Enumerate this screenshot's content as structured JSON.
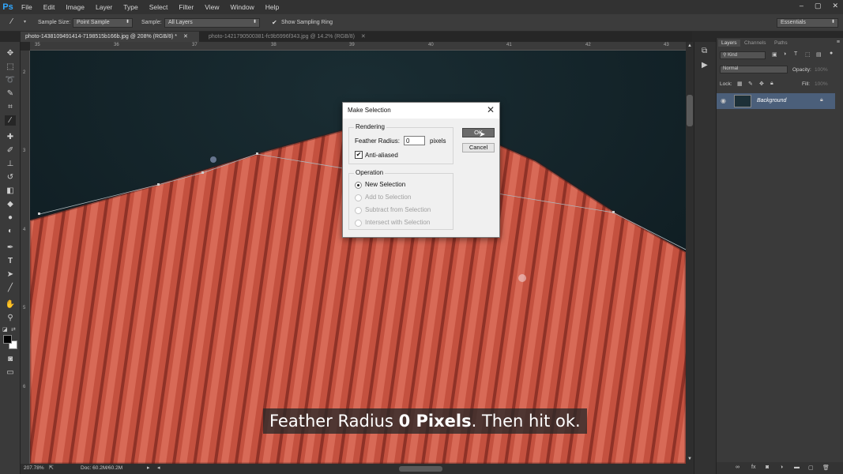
{
  "app": {
    "logo": "Ps"
  },
  "menu": [
    "File",
    "Edit",
    "Image",
    "Layer",
    "Type",
    "Select",
    "Filter",
    "View",
    "Window",
    "Help"
  ],
  "window_controls": [
    "–",
    "▢",
    "✕"
  ],
  "options": {
    "sample_size_label": "Sample Size:",
    "sample_size_value": "Point Sample",
    "sample_label": "Sample:",
    "sample_value": "All Layers",
    "show_ring_label": "Show Sampling Ring",
    "workspace": "Essentials"
  },
  "tabs": [
    {
      "label": "photo-1438109491414-7198515b166b.jpg @ 208% (RGB/8) *",
      "active": true
    },
    {
      "label": "photo-1421790500381-fc9b5996f343.jpg @ 14.2% (RGB/8)",
      "active": false
    }
  ],
  "ruler_top": [
    "35",
    "36",
    "37",
    "38",
    "39",
    "40",
    "41",
    "42",
    "43"
  ],
  "ruler_left": [
    "2",
    "3",
    "4",
    "5",
    "6"
  ],
  "status": {
    "zoom": "207.78%",
    "doc": "Doc: 60.2M/60.2M"
  },
  "panel": {
    "tabs": [
      "Layers",
      "Channels",
      "Paths"
    ],
    "kind": "Kind",
    "blend_mode": "Normal",
    "opacity_label": "Opacity:",
    "opacity_value": "100%",
    "lock_label": "Lock:",
    "fill_label": "Fill:",
    "fill_value": "100%",
    "layer_name": "Background"
  },
  "dialog": {
    "title": "Make Selection",
    "rendering_label": "Rendering",
    "feather_label": "Feather Radius:",
    "feather_value": "0",
    "feather_unit": "pixels",
    "antialias_label": "Anti-aliased",
    "antialias_checked": true,
    "operation_label": "Operation",
    "ops": [
      "New Selection",
      "Add to Selection",
      "Subtract from Selection",
      "Intersect with Selection"
    ],
    "ok_label": "OK",
    "cancel_label": "Cancel"
  },
  "subtitle": {
    "pre": "Feather Radius ",
    "bold": "0 Pixels",
    "post": ". Then hit ok."
  }
}
